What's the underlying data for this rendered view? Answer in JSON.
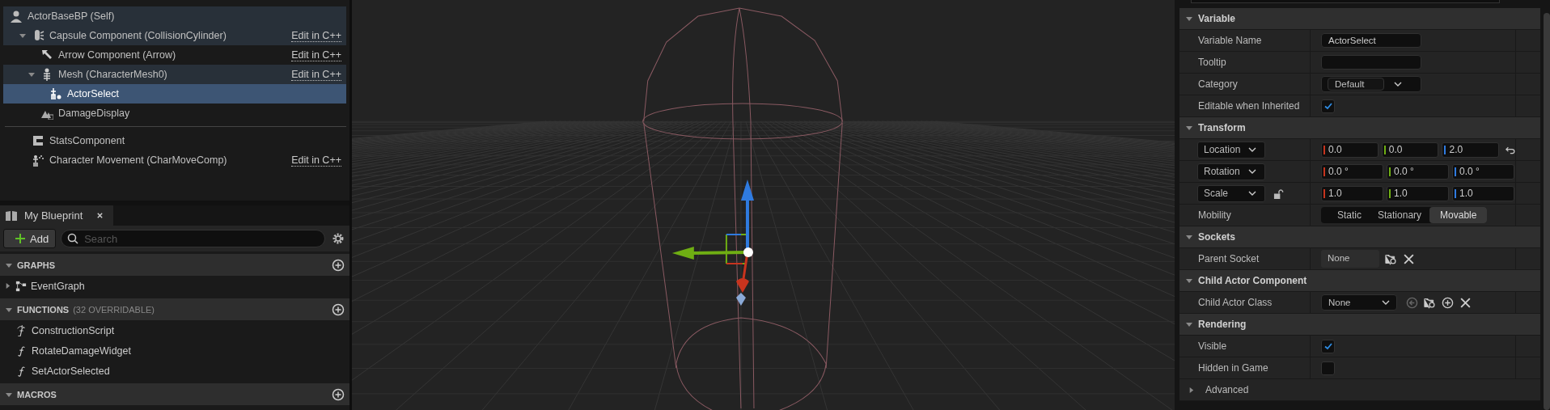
{
  "components": {
    "items": [
      {
        "label": "ActorBaseBP (Self)",
        "kind": "actor",
        "selected": false,
        "highlighted": true,
        "children": [
          {
            "label": "Capsule Component (CollisionCylinder)",
            "kind": "capsule",
            "selected": false,
            "highlighted": true,
            "expanded": true,
            "link": "Edit in C++",
            "children": [
              {
                "label": "Arrow Component (Arrow)",
                "kind": "arrow",
                "selected": false,
                "highlighted": false,
                "link": "Edit in C++"
              },
              {
                "label": "Mesh (CharacterMesh0)",
                "kind": "mesh",
                "selected": false,
                "highlighted": true,
                "expanded": true,
                "link": "Edit in C++",
                "children": [
                  {
                    "label": "ActorSelect",
                    "kind": "widget",
                    "selected": true
                  }
                ]
              },
              {
                "label": "DamageDisplay",
                "kind": "widget_component",
                "selected": false,
                "highlighted": false
              }
            ]
          }
        ]
      }
    ],
    "other_items": [
      {
        "label": "StatsComponent",
        "kind": "component",
        "selected": false
      },
      {
        "label": "Character Movement (CharMoveComp)",
        "kind": "movement",
        "selected": false,
        "link": "Edit in C++"
      }
    ]
  },
  "my_blueprint": {
    "tab": {
      "label": "My Blueprint",
      "selected": true
    },
    "add_button": "Add",
    "search": {
      "placeholder": "Search"
    },
    "sections": [
      {
        "title": "GRAPHS",
        "expanded": true,
        "items": [
          {
            "label": "EventGraph",
            "kind": "graph",
            "expanded": false
          }
        ]
      },
      {
        "title": "FUNCTIONS",
        "note": "(32 OVERRIDABLE)",
        "expanded": true,
        "items": [
          {
            "label": "ConstructionScript",
            "kind": "construction"
          },
          {
            "label": "RotateDamageWidget",
            "kind": "function"
          },
          {
            "label": "SetActorSelected",
            "kind": "function"
          }
        ]
      },
      {
        "title": "MACROS",
        "expanded": true
      }
    ]
  },
  "details": {
    "sections": [
      {
        "title": "Variable",
        "expanded": true,
        "rows": [
          {
            "kind": "text",
            "label": "Variable Name",
            "value": "ActorSelect"
          },
          {
            "kind": "text",
            "label": "Tooltip",
            "value": ""
          },
          {
            "kind": "combo",
            "label": "Category",
            "value": "Default"
          },
          {
            "kind": "checkbox",
            "label": "Editable when Inherited",
            "checked": true
          }
        ]
      },
      {
        "title": "Transform",
        "expanded": true,
        "rows": [
          {
            "kind": "vector",
            "label": "Location",
            "values": [
              "0.0",
              "0.0",
              "2.0"
            ],
            "reset": true
          },
          {
            "kind": "vector",
            "label": "Rotation",
            "values": [
              "0.0 °",
              "0.0 °",
              "0.0 °"
            ],
            "reset": false
          },
          {
            "kind": "vector",
            "label": "Scale",
            "values": [
              "1.0",
              "1.0",
              "1.0"
            ],
            "reset": false,
            "locked": false
          },
          {
            "kind": "segmented",
            "label": "Mobility",
            "options": [
              {
                "label": "Static",
                "selected": false
              },
              {
                "label": "Stationary",
                "selected": false
              },
              {
                "label": "Movable",
                "selected": true
              }
            ]
          }
        ]
      },
      {
        "title": "Sockets",
        "expanded": true,
        "rows": [
          {
            "kind": "socket",
            "label": "Parent Socket",
            "value": "None"
          }
        ]
      },
      {
        "title": "Child Actor Component",
        "expanded": true,
        "rows": [
          {
            "kind": "class",
            "label": "Child Actor Class",
            "value": "None"
          }
        ]
      },
      {
        "title": "Rendering",
        "expanded": true,
        "rows": [
          {
            "kind": "checkbox",
            "label": "Visible",
            "checked": true
          },
          {
            "kind": "checkbox",
            "label": "Hidden in Game",
            "checked": false
          },
          {
            "kind": "advanced",
            "label": "Advanced",
            "expanded": false
          }
        ]
      }
    ]
  }
}
